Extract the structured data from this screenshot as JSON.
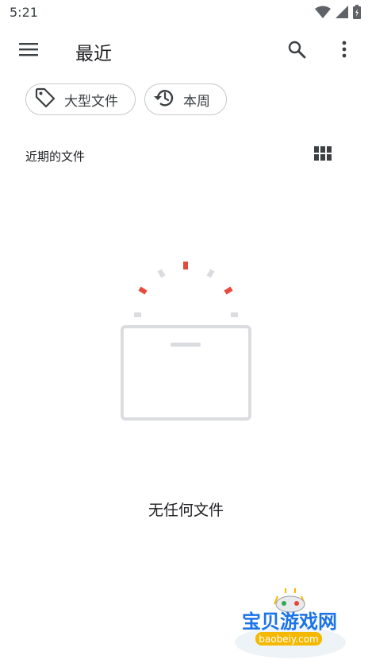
{
  "status_bar": {
    "time": "5:21",
    "icons": [
      "wifi-icon",
      "signal-icon",
      "battery-icon"
    ]
  },
  "app_bar": {
    "title": "最近",
    "icons": [
      "menu-icon",
      "search-icon",
      "more-vert-icon"
    ]
  },
  "chips": [
    {
      "label": "大型文件",
      "icon": "tag-icon"
    },
    {
      "label": "本周",
      "icon": "history-icon"
    }
  ],
  "section": {
    "label": "近期的文件",
    "view_icon": "grid-view-icon"
  },
  "empty_state": {
    "message": "无任何文件"
  },
  "watermark": {
    "brand": "宝贝游戏网",
    "domain": "baobeiy.com"
  },
  "colors": {
    "accent_red": "#e54b3c",
    "gray_illustration": "#dadce0",
    "text_primary": "#202124"
  }
}
